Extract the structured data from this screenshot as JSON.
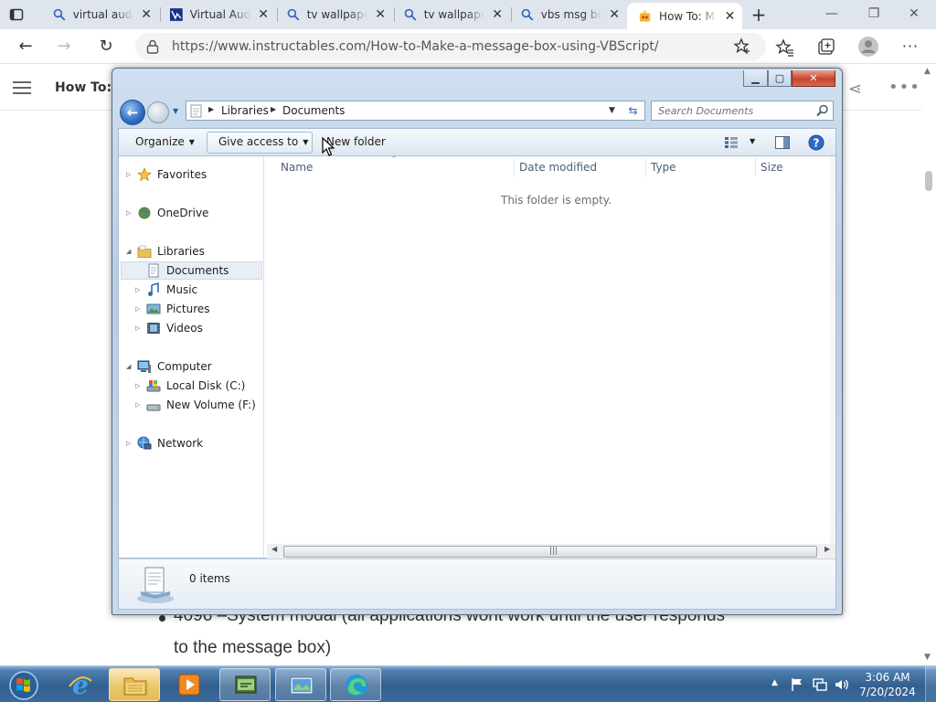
{
  "browser": {
    "tabs": [
      {
        "title": "virtual audio",
        "icon": "search-icon"
      },
      {
        "title": "Virtual Aud",
        "icon": "vb-logo-icon"
      },
      {
        "title": "tv wallpape",
        "icon": "search-icon"
      },
      {
        "title": "tv wallpape",
        "icon": "search-icon"
      },
      {
        "title": "vbs msg bo",
        "icon": "search-icon"
      },
      {
        "title": "How To: M",
        "icon": "instructables-robot-icon",
        "active": true
      }
    ],
    "url": "https://www.instructables.com/How-to-Make-a-message-box-using-VBScript/"
  },
  "website": {
    "header_title": "How To: M",
    "line1": "4096 –System modal (all applications wont work until the user responds",
    "line2": "to the message box)"
  },
  "explorer": {
    "breadcrumb": [
      "Libraries",
      "Documents"
    ],
    "search_placeholder": "Search Documents",
    "toolbar": {
      "organize": "Organize",
      "give_access": "Give access to",
      "new_folder": "New folder"
    },
    "nav": {
      "favorites": "Favorites",
      "onedrive": "OneDrive",
      "libraries": "Libraries",
      "documents": "Documents",
      "music": "Music",
      "pictures": "Pictures",
      "videos": "Videos",
      "computer": "Computer",
      "local_disk": "Local Disk (C:)",
      "new_volume": "New Volume (F:)",
      "network": "Network"
    },
    "columns": [
      "Name",
      "Date modified",
      "Type",
      "Size"
    ],
    "empty_message": "This folder is empty.",
    "status_items": "0 items"
  },
  "taskbar": {
    "time": "3:06 AM",
    "date": "7/20/2024"
  },
  "colors": {
    "taskbar": "#335f8e",
    "active_tab": "#ffffff",
    "tabstrip": "#dfe5ec",
    "explorer_frame": "#b8cde4"
  }
}
